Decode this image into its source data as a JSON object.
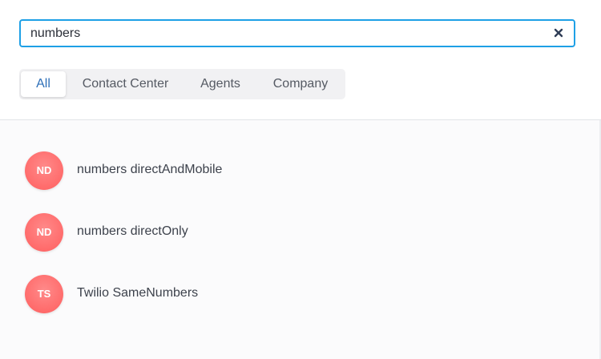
{
  "search": {
    "value": "numbers",
    "clear_icon": "close-icon"
  },
  "tabs": [
    {
      "label": "All",
      "active": true
    },
    {
      "label": "Contact Center",
      "active": false
    },
    {
      "label": "Agents",
      "active": false
    },
    {
      "label": "Company",
      "active": false
    }
  ],
  "results": [
    {
      "initials": "ND",
      "name": "numbers directAndMobile"
    },
    {
      "initials": "ND",
      "name": "numbers directOnly"
    },
    {
      "initials": "TS",
      "name": "Twilio SameNumbers"
    }
  ],
  "colors": {
    "focus_border": "#1ea0e6",
    "active_tab_text": "#2d6fb8",
    "avatar_bg": "#ff6b6b"
  }
}
